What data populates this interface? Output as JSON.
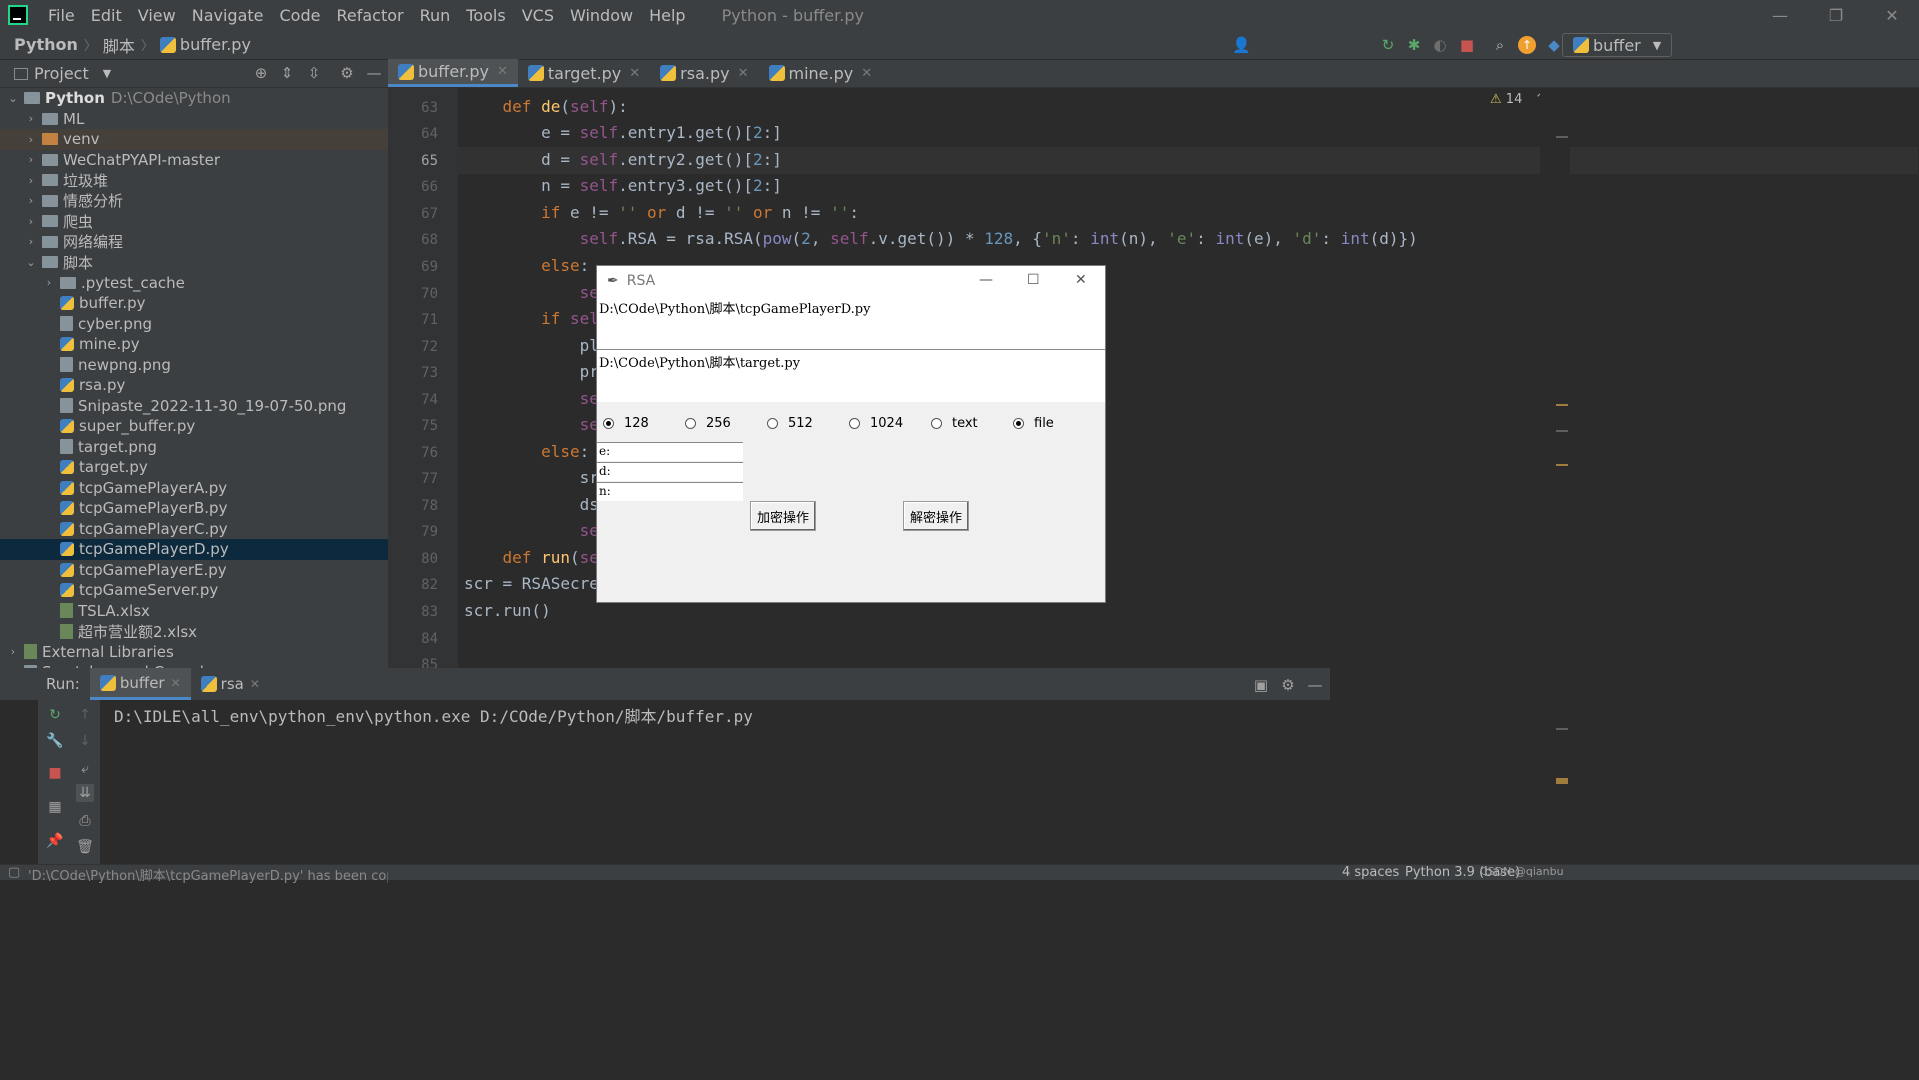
{
  "window": {
    "title": "Python - buffer.py"
  },
  "menu": [
    "File",
    "Edit",
    "View",
    "Navigate",
    "Code",
    "Refactor",
    "Run",
    "Tools",
    "VCS",
    "Window",
    "Help"
  ],
  "breadcrumb": [
    "Python",
    "脚本",
    "buffer.py"
  ],
  "run_config": "buffer",
  "project": {
    "header": "Project",
    "root_name": "Python",
    "root_path": "D:\\COde\\Python",
    "items": [
      {
        "label": "ML",
        "type": "folder",
        "depth": 1,
        "arrow": "›"
      },
      {
        "label": "venv",
        "type": "folder-orange",
        "depth": 1,
        "arrow": "›"
      },
      {
        "label": "WeChatPYAPI-master",
        "type": "folder",
        "depth": 1,
        "arrow": "›"
      },
      {
        "label": "垃圾堆",
        "type": "folder",
        "depth": 1,
        "arrow": "›"
      },
      {
        "label": "情感分析",
        "type": "folder",
        "depth": 1,
        "arrow": "›"
      },
      {
        "label": "爬虫",
        "type": "folder",
        "depth": 1,
        "arrow": "›"
      },
      {
        "label": "网络编程",
        "type": "folder",
        "depth": 1,
        "arrow": "›"
      },
      {
        "label": "脚本",
        "type": "folder",
        "depth": 1,
        "arrow": "⌄"
      },
      {
        "label": ".pytest_cache",
        "type": "folder",
        "depth": 2,
        "arrow": "›"
      },
      {
        "label": "buffer.py",
        "type": "py",
        "depth": 2
      },
      {
        "label": "cyber.png",
        "type": "file",
        "depth": 2
      },
      {
        "label": "mine.py",
        "type": "py",
        "depth": 2
      },
      {
        "label": "newpng.png",
        "type": "file",
        "depth": 2
      },
      {
        "label": "rsa.py",
        "type": "py",
        "depth": 2
      },
      {
        "label": "Snipaste_2022-11-30_19-07-50.png",
        "type": "file",
        "depth": 2
      },
      {
        "label": "super_buffer.py",
        "type": "py",
        "depth": 2
      },
      {
        "label": "target.png",
        "type": "file",
        "depth": 2
      },
      {
        "label": "target.py",
        "type": "py",
        "depth": 2
      },
      {
        "label": "tcpGamePlayerA.py",
        "type": "py",
        "depth": 2
      },
      {
        "label": "tcpGamePlayerB.py",
        "type": "py",
        "depth": 2
      },
      {
        "label": "tcpGamePlayerC.py",
        "type": "py",
        "depth": 2
      },
      {
        "label": "tcpGamePlayerD.py",
        "type": "py",
        "depth": 2,
        "selected": true
      },
      {
        "label": "tcpGamePlayerE.py",
        "type": "py",
        "depth": 2
      },
      {
        "label": "tcpGameServer.py",
        "type": "py",
        "depth": 2
      },
      {
        "label": "TSLA.xlsx",
        "type": "xls",
        "depth": 2
      },
      {
        "label": "超市营业额2.xlsx",
        "type": "xls",
        "depth": 2
      }
    ],
    "external": "External Libraries",
    "scratches": "Scratches and Consoles"
  },
  "tabs": [
    {
      "label": "buffer.py",
      "active": true
    },
    {
      "label": "target.py"
    },
    {
      "label": "rsa.py"
    },
    {
      "label": "mine.py"
    }
  ],
  "warnings": "14",
  "line_numbers": [
    "63",
    "64",
    "65",
    "66",
    "67",
    "68",
    "69",
    "70",
    "71",
    "72",
    "73",
    "74",
    "75",
    "76",
    "77",
    "78",
    "79",
    "80",
    "82",
    "83",
    "84",
    "85"
  ],
  "run": {
    "label": "Run:",
    "tabs": [
      "buffer",
      "rsa"
    ],
    "output": "D:\\IDLE\\all_env\\python_env\\python.exe D:/COde/Python/脚本/buffer.py"
  },
  "status": {
    "message": "'D:\\COde\\Python\\脚本\\tcpGamePlayerD.py' has been copied.",
    "indent": "4 spaces",
    "interpreter": "Python 3.9 (base)",
    "watermark": "CSDN @qianbu"
  },
  "rsa_dialog": {
    "title": "RSA",
    "entry1": "D:\\COde\\Python\\脚本\\tcpGamePlayerD.py",
    "entry2": "D:\\COde\\Python\\脚本\\target.py",
    "radios": [
      {
        "label": "128",
        "checked": true
      },
      {
        "label": "256"
      },
      {
        "label": "512"
      },
      {
        "label": "1024"
      },
      {
        "label": "text"
      },
      {
        "label": "file",
        "checked": true
      }
    ],
    "field_e": "e:",
    "field_d": "d:",
    "field_n": "n:",
    "encrypt": "加密操作",
    "decrypt": "解密操作"
  }
}
